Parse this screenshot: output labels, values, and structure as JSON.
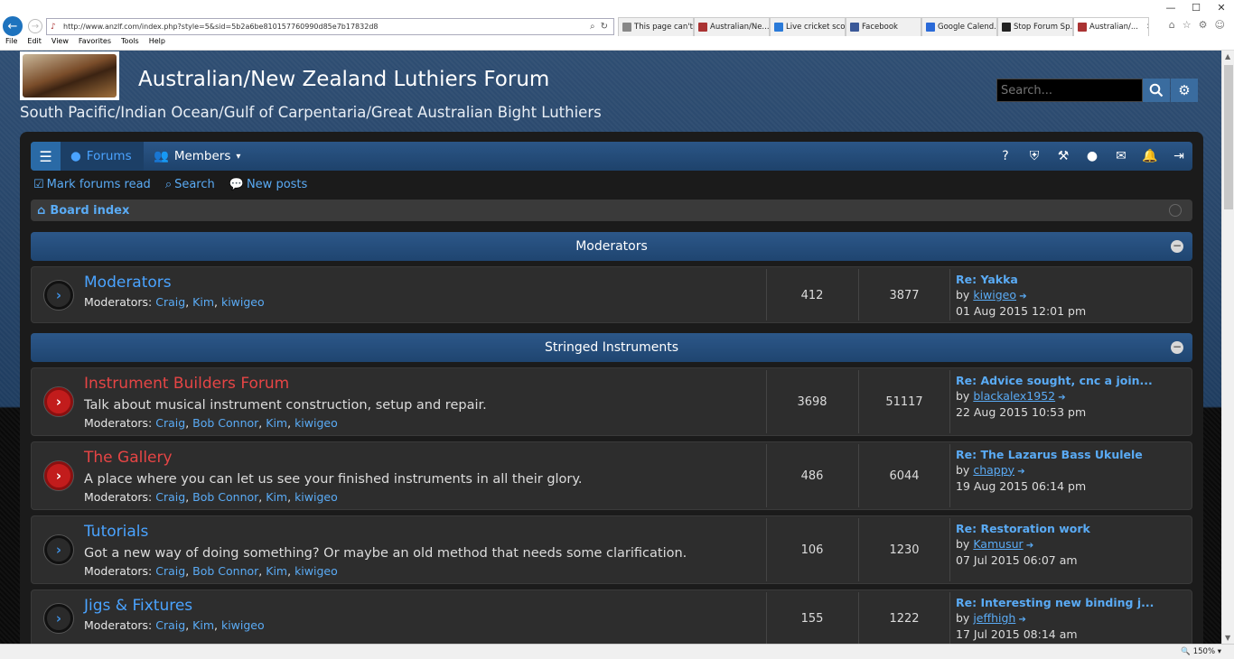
{
  "browser": {
    "url": "http://www.anzlf.com/index.php?style=5&sid=5b2a6be810157760990d85e7b17832d8",
    "tabs": [
      {
        "label": "This page can't...",
        "icon_color": "#888"
      },
      {
        "label": "Australian/Ne...",
        "icon_color": "#a33"
      },
      {
        "label": "Live cricket sco...",
        "icon_color": "#2a7ad8"
      },
      {
        "label": "Facebook",
        "icon_color": "#3b5998"
      },
      {
        "label": "Google Calend...",
        "icon_color": "#2a6ad8"
      },
      {
        "label": "Stop Forum Sp...",
        "icon_color": "#222"
      },
      {
        "label": "Australian/...",
        "icon_color": "#a33"
      }
    ],
    "menu": [
      "File",
      "Edit",
      "View",
      "Favorites",
      "Tools",
      "Help"
    ],
    "zoom": "150%"
  },
  "site": {
    "title": "Australian/New Zealand Luthiers Forum",
    "description": "South Pacific/Indian Ocean/Gulf of Carpentaria/Great Australian Bight Luthiers",
    "search_placeholder": "Search..."
  },
  "nav": {
    "forums_label": "Forums",
    "members_label": "Members",
    "quick_links": [
      "Mark forums read",
      "Search",
      "New posts"
    ],
    "breadcrumb": "Board index"
  },
  "categories": [
    {
      "name": "Moderators",
      "forums": [
        {
          "title": "Moderators",
          "description": "",
          "status": "read",
          "moderators_label": "Moderators:",
          "moderators": [
            "Craig",
            "Kim",
            "kiwigeo"
          ],
          "topics": "412",
          "posts": "3877",
          "last_title": "Re: Yakka",
          "last_by": "by",
          "last_author": "kiwigeo",
          "last_date": "01 Aug 2015 12:01 pm"
        }
      ]
    },
    {
      "name": "Stringed Instruments",
      "forums": [
        {
          "title": "Instrument Builders Forum",
          "description": "Talk about musical instrument construction, setup and repair.",
          "status": "unread",
          "moderators_label": "Moderators:",
          "moderators": [
            "Craig",
            "Bob Connor",
            "Kim",
            "kiwigeo"
          ],
          "topics": "3698",
          "posts": "51117",
          "last_title": "Re: Advice sought, cnc a join...",
          "last_by": "by",
          "last_author": "blackalex1952",
          "last_date": "22 Aug 2015 10:53 pm"
        },
        {
          "title": "The Gallery",
          "description": "A place where you can let us see your finished instruments in all their glory.",
          "status": "unread",
          "moderators_label": "Moderators:",
          "moderators": [
            "Craig",
            "Bob Connor",
            "Kim",
            "kiwigeo"
          ],
          "topics": "486",
          "posts": "6044",
          "last_title": "Re: The Lazarus Bass Ukulele",
          "last_by": "by",
          "last_author": "chappy",
          "last_date": "19 Aug 2015 06:14 pm"
        },
        {
          "title": "Tutorials",
          "description": "Got a new way of doing something? Or maybe an old method that needs some clarification.",
          "status": "read",
          "moderators_label": "Moderators:",
          "moderators": [
            "Craig",
            "Bob Connor",
            "Kim",
            "kiwigeo"
          ],
          "topics": "106",
          "posts": "1230",
          "last_title": "Re: Restoration work",
          "last_by": "by",
          "last_author": "Kamusur",
          "last_date": "07 Jul 2015 06:07 am"
        },
        {
          "title": "Jigs & Fixtures",
          "description": "",
          "status": "read",
          "moderators_label": "Moderators:",
          "moderators": [
            "Craig",
            "Kim",
            "kiwigeo"
          ],
          "topics": "155",
          "posts": "1222",
          "last_title": "Re: Interesting new binding j...",
          "last_by": "by",
          "last_author": "jeffhigh",
          "last_date": "17 Jul 2015 08:14 am"
        }
      ]
    }
  ]
}
